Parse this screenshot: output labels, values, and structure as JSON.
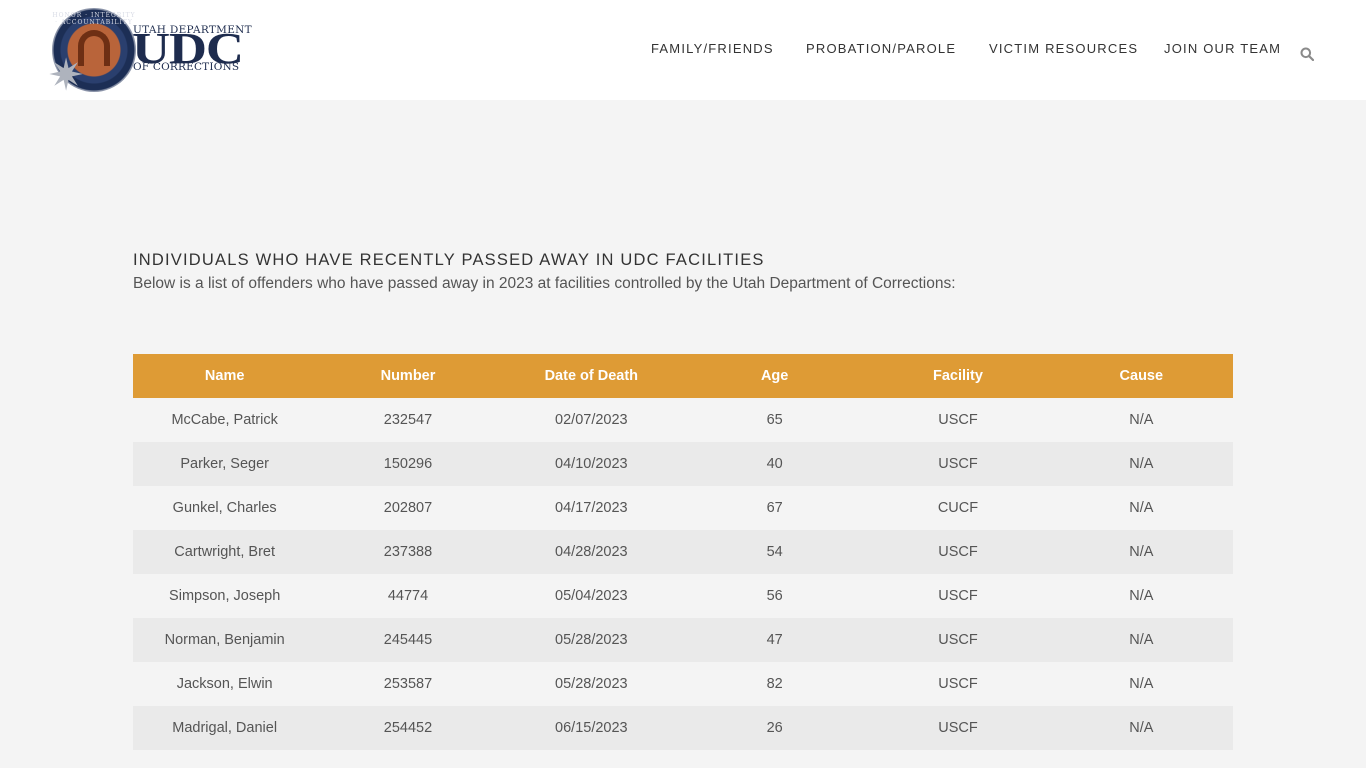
{
  "header": {
    "logo": {
      "line_top": "UTAH DEPARTMENT",
      "line_main": "UDC",
      "line_bottom": "OF CORRECTIONS",
      "seal_text": "HONOR · INTEGRITY · ACCOUNTABILITY"
    },
    "nav": [
      "FAMILY/FRIENDS",
      "PROBATION/PAROLE",
      "VICTIM RESOURCES",
      "JOIN OUR TEAM"
    ],
    "search_icon": "search-icon"
  },
  "main": {
    "title": "INDIVIDUALS WHO HAVE RECENTLY PASSED AWAY IN UDC FACILITIES",
    "subtitle": "Below is a list of offenders who have passed away in 2023 at facilities controlled by the Utah Department of Corrections:",
    "table": {
      "columns": [
        "Name",
        "Number",
        "Date of Death",
        "Age",
        "Facility",
        "Cause"
      ],
      "rows": [
        [
          "McCabe, Patrick",
          "232547",
          "02/07/2023",
          "65",
          "USCF",
          "N/A"
        ],
        [
          "Parker, Seger",
          "150296",
          "04/10/2023",
          "40",
          "USCF",
          "N/A"
        ],
        [
          "Gunkel, Charles",
          "202807",
          "04/17/2023",
          "67",
          "CUCF",
          "N/A"
        ],
        [
          "Cartwright, Bret",
          "237388",
          "04/28/2023",
          "54",
          "USCF",
          "N/A"
        ],
        [
          "Simpson, Joseph",
          "44774",
          "05/04/2023",
          "56",
          "USCF",
          "N/A"
        ],
        [
          "Norman, Benjamin",
          "245445",
          "05/28/2023",
          "47",
          "USCF",
          "N/A"
        ],
        [
          "Jackson, Elwin",
          "253587",
          "05/28/2023",
          "82",
          "USCF",
          "N/A"
        ],
        [
          "Madrigal, Daniel",
          "254452",
          "06/15/2023",
          "26",
          "USCF",
          "N/A"
        ]
      ]
    }
  },
  "colors": {
    "header_bg": "#ffffff",
    "page_bg": "#f4f4f4",
    "table_header_bg": "#de9b35",
    "row_alt_bg": "#eaeaea",
    "brand_navy": "#1e2c4e"
  }
}
